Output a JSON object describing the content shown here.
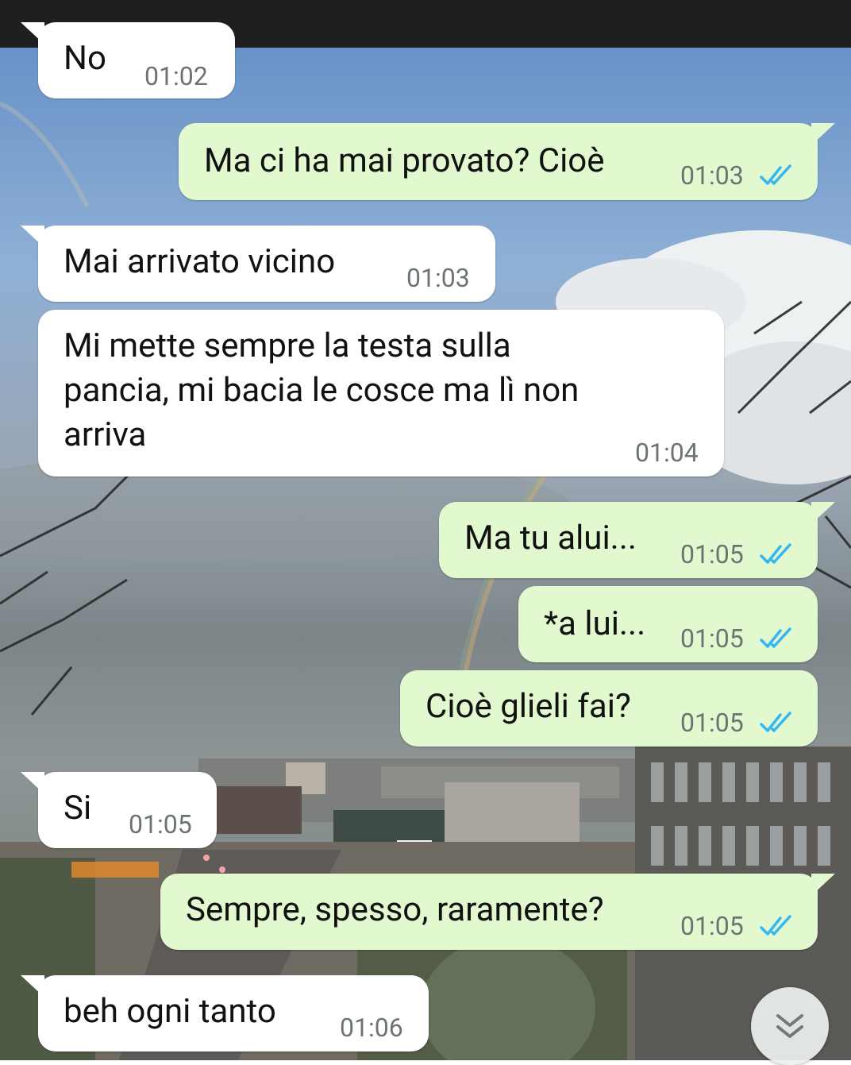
{
  "colors": {
    "incoming_bubble": "#ffffff",
    "outgoing_bubble": "#e2f8cf",
    "timestamp": "#6b7470",
    "read_ticks": "#34b7f1"
  },
  "messages": [
    {
      "direction": "in",
      "text": "No",
      "time": "01:02"
    },
    {
      "direction": "out",
      "text": "Ma ci ha mai provato? Cioè",
      "time": "01:03",
      "status": "read"
    },
    {
      "direction": "in",
      "text": "Mai arrivato vicino",
      "time": "01:03"
    },
    {
      "direction": "in",
      "lines": [
        "Mi mette sempre la testa sulla",
        "pancia, mi bacia le cosce ma lì non",
        "arriva"
      ],
      "time": "01:04"
    },
    {
      "direction": "out",
      "text": "Ma tu alui...",
      "time": "01:05",
      "status": "read"
    },
    {
      "direction": "out",
      "text": "*a lui...",
      "time": "01:05",
      "status": "read"
    },
    {
      "direction": "out",
      "text": "Cioè glieli fai?",
      "time": "01:05",
      "status": "read"
    },
    {
      "direction": "in",
      "text": "Si",
      "time": "01:05"
    },
    {
      "direction": "out",
      "text": "Sempre, spesso, raramente?",
      "time": "01:05",
      "status": "read"
    },
    {
      "direction": "in",
      "text": "beh ogni tanto",
      "time": "01:06"
    }
  ],
  "scroll_button": {
    "icon": "double-chevron-down-icon"
  }
}
